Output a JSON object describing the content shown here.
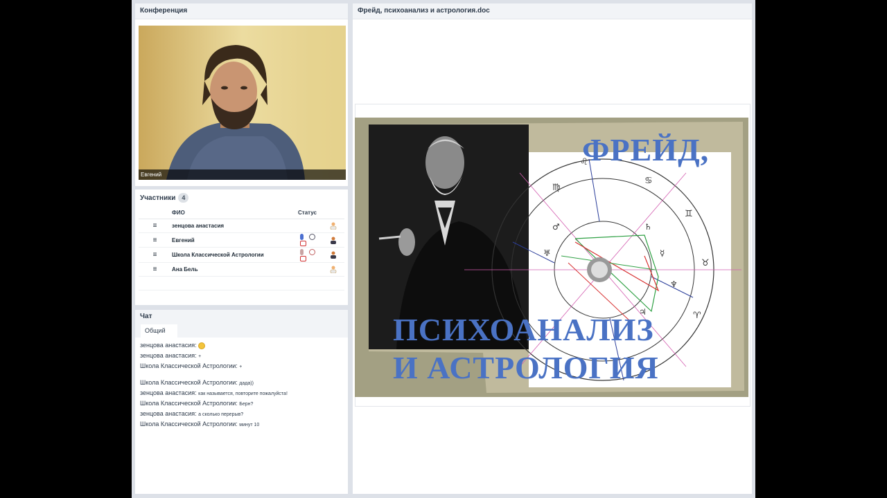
{
  "conference": {
    "title": "Конференция",
    "speaker_name": "Евгений"
  },
  "participants": {
    "title": "Участники",
    "count": "4",
    "columns": {
      "name": "ФИО",
      "status": "Статус"
    },
    "rows": [
      {
        "name": "зенцова анастасия"
      },
      {
        "name": "Евгений"
      },
      {
        "name": "Школа Классической Астрологии"
      },
      {
        "name": "Ана Бель"
      }
    ]
  },
  "chat": {
    "title": "Чат",
    "tab": "Общий",
    "messages": [
      {
        "author": "зенцова анастасия:",
        "text": "",
        "emoji": "smile-emoji"
      },
      {
        "author": "зенцова анастасия:",
        "text": "+"
      },
      {
        "author": "Школа Классической Астрологии:",
        "text": "+"
      },
      {
        "author": "Школа Классической Астрологии:",
        "text": "дада))"
      },
      {
        "author": "зенцова анастасия:",
        "text": "как называется, повторите пожалуйста!"
      },
      {
        "author": "Школа Классической Астрологии:",
        "text": "Берн?"
      },
      {
        "author": "зенцова анастасия:",
        "text": "а сколько перерыв?"
      },
      {
        "author": "Школа Классической Астрологии:",
        "text": "минут 10"
      }
    ]
  },
  "document": {
    "title": "Фрейд, психоанализ и астрология.doc",
    "slide": {
      "title_top": "ФРЕЙД,",
      "title_line2": "ПСИХОАНАЛИЗ",
      "title_line3": "И АСТРОЛОГИЯ"
    }
  },
  "colors": {
    "title_blue": "#4a72c4",
    "panel_bg": "#dde1e8",
    "header_bg": "#f2f4f7"
  }
}
